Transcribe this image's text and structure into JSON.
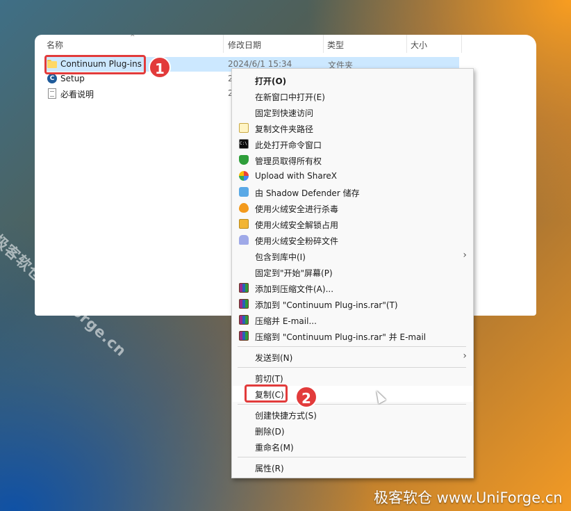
{
  "columns": {
    "name": "名称",
    "modified": "修改日期",
    "type": "类型",
    "size": "大小"
  },
  "files": [
    {
      "name": "Continuum Plug-ins",
      "date": "2024/6/1 15:34",
      "type": "文件夹",
      "icon": "folder-icon"
    },
    {
      "name": "Setup",
      "date": "2",
      "type": "",
      "icon": "setup-icon"
    },
    {
      "name": "必看说明",
      "date": "2",
      "type": "",
      "icon": "document-icon"
    }
  ],
  "badges": {
    "step1": "1",
    "step2": "2"
  },
  "menu": {
    "items": [
      {
        "label": "打开(O)",
        "icon": "none"
      },
      {
        "label": "在新窗口中打开(E)",
        "icon": "none"
      },
      {
        "label": "固定到快速访问",
        "icon": "none"
      },
      {
        "label": "复制文件夹路径",
        "icon": "copy-path-icon"
      },
      {
        "label": "此处打开命令窗口",
        "icon": "command-prompt-icon"
      },
      {
        "label": "管理员取得所有权",
        "icon": "shield-icon"
      },
      {
        "label": "Upload with ShareX",
        "icon": "sharex-icon"
      },
      {
        "label": "由 Shadow Defender 储存",
        "icon": "shadow-defender-icon"
      },
      {
        "label": "使用火绒安全进行杀毒",
        "icon": "huorong-fire-icon"
      },
      {
        "label": "使用火绒安全解锁占用",
        "icon": "unlock-folder-icon"
      },
      {
        "label": "使用火绒安全粉碎文件",
        "icon": "shredder-icon"
      },
      {
        "label": "包含到库中(I)",
        "icon": "none"
      },
      {
        "label": "固定到\"开始\"屏幕(P)",
        "icon": "none"
      },
      {
        "label": "添加到压缩文件(A)...",
        "icon": "winrar-icon"
      },
      {
        "label": "添加到 \"Continuum Plug-ins.rar\"(T)",
        "icon": "winrar-icon"
      },
      {
        "label": "压缩并 E-mail...",
        "icon": "winrar-icon"
      },
      {
        "label": "压缩到 \"Continuum Plug-ins.rar\" 并 E-mail",
        "icon": "winrar-icon"
      },
      {
        "label": "发送到(N)",
        "icon": "none"
      },
      {
        "label": "剪切(T)",
        "icon": "none"
      },
      {
        "label": "复制(C)",
        "icon": "none"
      },
      {
        "label": "创建快捷方式(S)",
        "icon": "none"
      },
      {
        "label": "删除(D)",
        "icon": "none"
      },
      {
        "label": "重命名(M)",
        "icon": "none"
      },
      {
        "label": "属性(R)",
        "icon": "none"
      }
    ],
    "submenu_arrow": "›"
  },
  "watermarks": {
    "diagonal": "极客软仓 UniForge.cn",
    "bottom": "极客软仓 www.UniForge.cn"
  },
  "colors": {
    "highlight": "#e23b3b",
    "selection": "#cce8ff"
  }
}
